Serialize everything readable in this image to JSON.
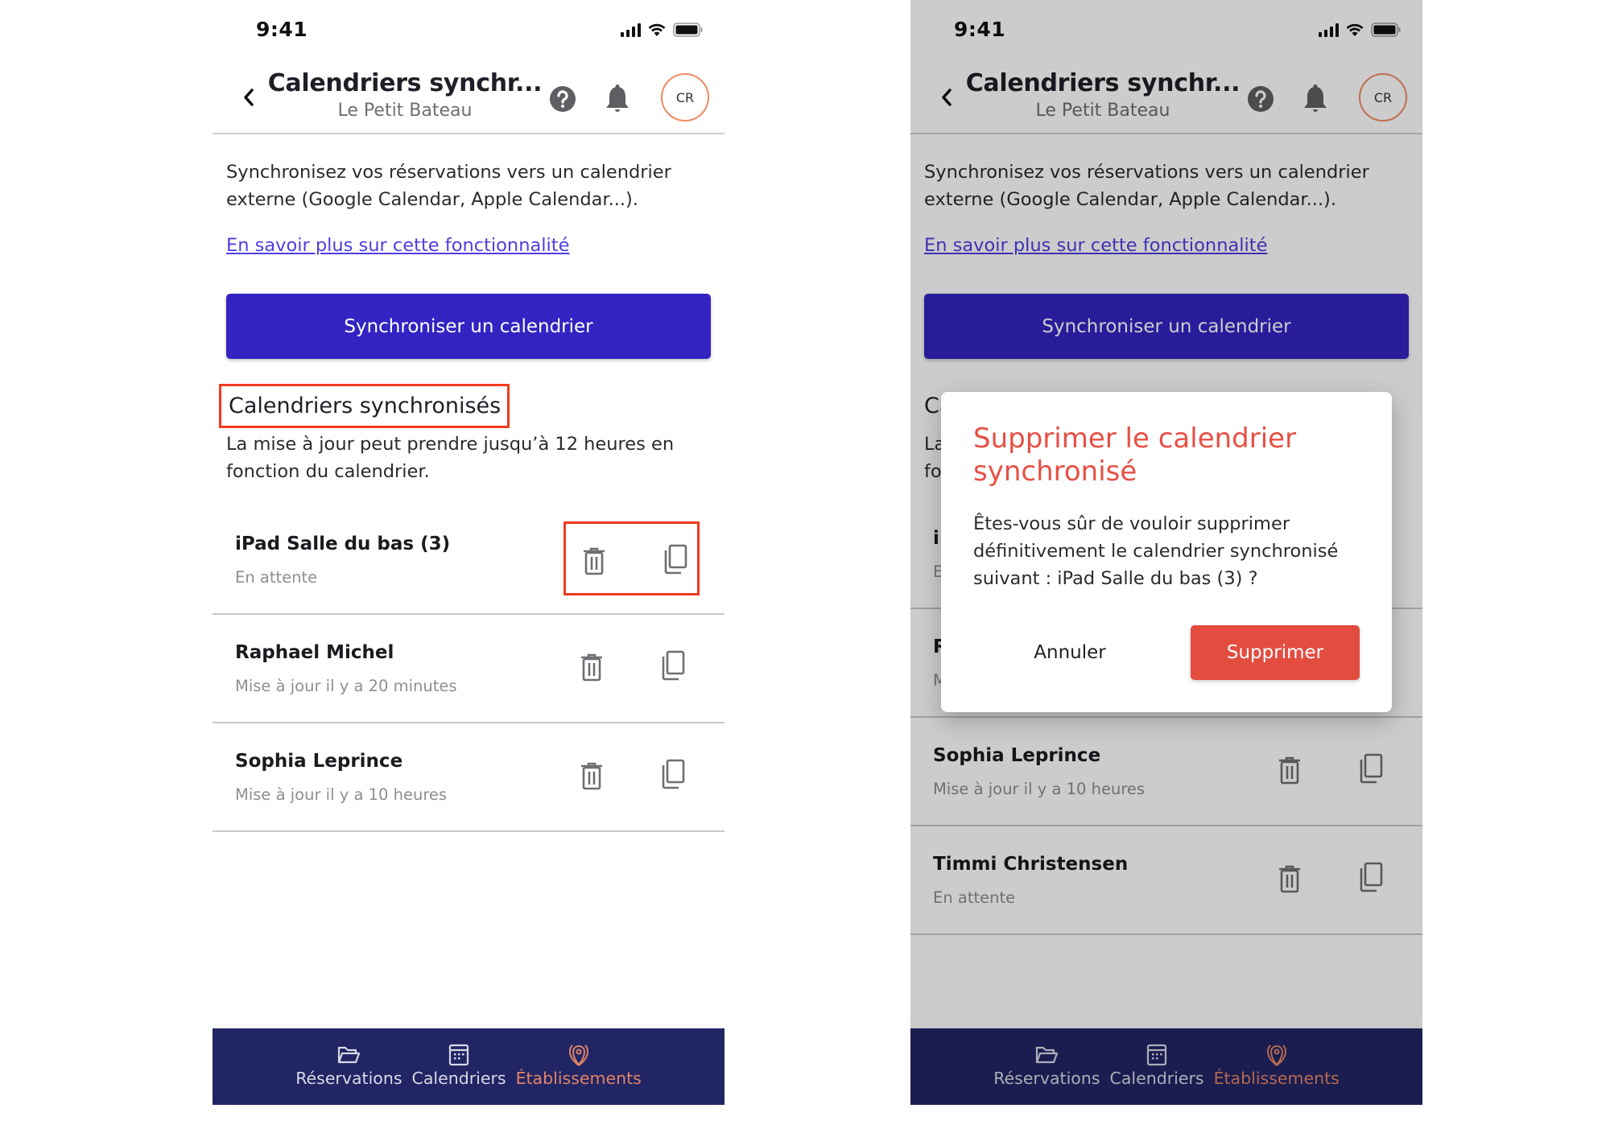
{
  "status_bar": {
    "time": "9:41"
  },
  "header": {
    "title": "Calendriers synchr...",
    "subtitle": "Le Petit Bateau",
    "avatar_initials": "CR",
    "icons": {
      "back": "chevron-left-icon",
      "help": "question-circle-icon",
      "notifications": "bell-icon"
    }
  },
  "intro": {
    "text": "Synchronisez vos réservations vers un calendrier externe (Google Calendar, Apple Calendar...).",
    "link_label": "En savoir plus sur cette fonctionnalité"
  },
  "sync_button_label": "Synchroniser un calendrier",
  "section": {
    "heading": "Calendriers synchronisés",
    "subtitle": "La mise à jour peut prendre jusqu’à 12 heures en fonction du calendrier."
  },
  "screens": {
    "left": {
      "calendars": [
        {
          "name": "iPad Salle du bas (3)",
          "status": "En attente"
        },
        {
          "name": "Raphael Michel",
          "status": "Mise à jour il y a 20 minutes"
        },
        {
          "name": "Sophia Leprince",
          "status": "Mise à jour il y a 10 heures"
        }
      ]
    },
    "right": {
      "calendars": [
        {
          "name": "iPad Salle du bas (3)",
          "status": "En attente"
        },
        {
          "name": "Raphael Michel",
          "status": "Mise à jour il y a 20 minutes"
        },
        {
          "name": "Sophia Leprince",
          "status": "Mise à jour il y a 10 heures"
        },
        {
          "name": "Timmi Christensen",
          "status": "En attente"
        }
      ]
    }
  },
  "dialog": {
    "title": "Supprimer le calendrier synchronisé",
    "body": "Êtes-vous sûr de vouloir supprimer définitivement le calendrier synchronisé suivant : iPad Salle du bas (3) ?",
    "cancel_label": "Annuler",
    "confirm_label": "Supprimer"
  },
  "bottom_nav": {
    "items": [
      {
        "label": "Réservations",
        "icon": "folder-icon",
        "active": false
      },
      {
        "label": "Calendriers",
        "icon": "calendar-icon",
        "active": false
      },
      {
        "label": "Établissements",
        "icon": "location-pin-icon",
        "active": true
      }
    ]
  },
  "colors": {
    "primary": "#3223c2",
    "nav_background": "#222564",
    "active_nav": "#df8466",
    "danger": "#e34d40",
    "link": "#4f3ee0",
    "avatar_ring": "#f08a63",
    "annotation": "#f23a1e"
  }
}
